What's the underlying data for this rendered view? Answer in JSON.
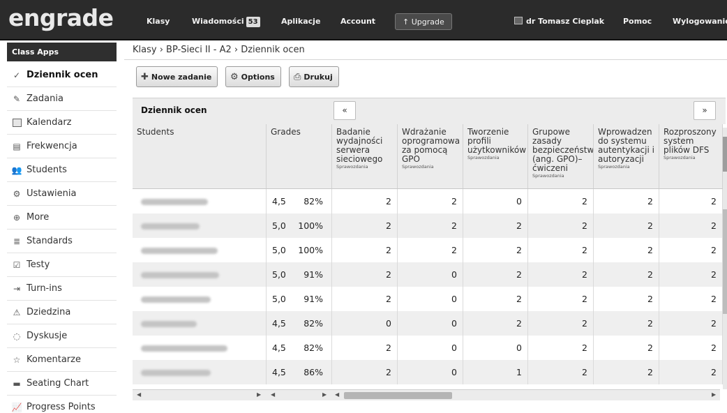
{
  "app": {
    "logo": "engrade"
  },
  "nav": {
    "klasy": "Klasy",
    "wiadomosci": "Wiadomości",
    "wiadomosci_count": "53",
    "aplikacje": "Aplikacje",
    "account": "Account",
    "upgrade": "Upgrade",
    "user": "dr Tomasz Cieplak",
    "pomoc": "Pomoc",
    "wyloguj": "Wylogowanie"
  },
  "sidebar": {
    "heading": "Class Apps",
    "items": [
      {
        "label": "Dziennik ocen",
        "icon": "checkmark-icon",
        "active": true
      },
      {
        "label": "Zadania",
        "icon": "assignment-icon"
      },
      {
        "label": "Kalendarz",
        "icon": "calendar-icon"
      },
      {
        "label": "Frekwencja",
        "icon": "attendance-icon"
      },
      {
        "label": "Students",
        "icon": "students-icon"
      },
      {
        "label": "Ustawienia",
        "icon": "gear-icon"
      },
      {
        "label": "More",
        "icon": "more-icon"
      },
      {
        "label": "Standards",
        "icon": "standards-icon"
      },
      {
        "label": "Testy",
        "icon": "test-icon"
      },
      {
        "label": "Turn-ins",
        "icon": "turnin-icon"
      },
      {
        "label": "Dziedzina",
        "icon": "warning-icon"
      },
      {
        "label": "Dyskusje",
        "icon": "discussion-icon"
      },
      {
        "label": "Komentarze",
        "icon": "star-icon"
      },
      {
        "label": "Seating Chart",
        "icon": "seating-icon"
      },
      {
        "label": "Progress Points",
        "icon": "progress-icon"
      }
    ]
  },
  "breadcrumb": "Klasy › BP-Sieci II - A2 › Dziennik ocen",
  "toolbar": {
    "new_task": "Nowe zadanie",
    "options": "Options",
    "print": "Drukuj"
  },
  "grid": {
    "title": "Dziennik ocen",
    "prev": "«",
    "next": "»",
    "students_header": "Students",
    "grades_header": "Grades",
    "assignment_sub": "Sprawozdania",
    "assignments": [
      "Badanie wydajności serwera sieciowego",
      "Wdrażanie oprogramowa za pomocą GPO",
      "Tworzenie profili użytkowników",
      "Grupowe zasady bezpieczeństw (ang. GPO)– ćwiczeni",
      "Wprowadzen do systemu autentykacji i autoryzacji",
      "Rozproszony system plików DFS"
    ],
    "rows": [
      {
        "grade": "4,5",
        "pct": "82%",
        "scores": [
          "2",
          "2",
          "0",
          "2",
          "2",
          "2"
        ]
      },
      {
        "grade": "5,0",
        "pct": "100%",
        "scores": [
          "2",
          "2",
          "2",
          "2",
          "2",
          "2"
        ]
      },
      {
        "grade": "5,0",
        "pct": "100%",
        "scores": [
          "2",
          "2",
          "2",
          "2",
          "2",
          "2"
        ]
      },
      {
        "grade": "5,0",
        "pct": "91%",
        "scores": [
          "2",
          "0",
          "2",
          "2",
          "2",
          "2"
        ]
      },
      {
        "grade": "5,0",
        "pct": "91%",
        "scores": [
          "2",
          "0",
          "2",
          "2",
          "2",
          "2"
        ]
      },
      {
        "grade": "4,5",
        "pct": "82%",
        "scores": [
          "0",
          "0",
          "2",
          "2",
          "2",
          "2"
        ]
      },
      {
        "grade": "4,5",
        "pct": "82%",
        "scores": [
          "2",
          "0",
          "0",
          "2",
          "2",
          "2"
        ]
      },
      {
        "grade": "4,5",
        "pct": "86%",
        "scores": [
          "2",
          "0",
          "1",
          "2",
          "2",
          "2"
        ]
      }
    ]
  }
}
